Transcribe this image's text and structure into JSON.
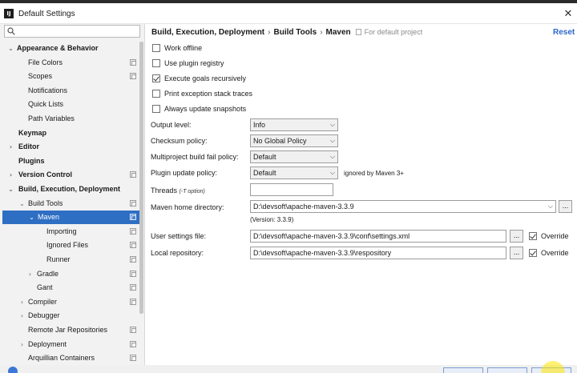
{
  "window": {
    "title": "Default Settings",
    "app_icon_text": "IJ",
    "close_glyph": "✕"
  },
  "sidebar": {
    "search": {
      "value": "",
      "placeholder": "",
      "icon": "search-icon"
    },
    "items": [
      {
        "label": "Appearance & Behavior",
        "bold": true,
        "arrow": "expanded",
        "copy_icon": false
      },
      {
        "label": "File Colors",
        "bold": false,
        "arrow": "none",
        "copy_icon": true
      },
      {
        "label": "Scopes",
        "bold": false,
        "arrow": "none",
        "copy_icon": true
      },
      {
        "label": "Notifications",
        "bold": false,
        "arrow": "none",
        "copy_icon": false
      },
      {
        "label": "Quick Lists",
        "bold": false,
        "arrow": "none",
        "copy_icon": false
      },
      {
        "label": "Path Variables",
        "bold": false,
        "arrow": "none",
        "copy_icon": false
      },
      {
        "label": "Keymap",
        "bold": true,
        "arrow": "none",
        "copy_icon": false
      },
      {
        "label": "Editor",
        "bold": true,
        "arrow": "collapsed",
        "copy_icon": false
      },
      {
        "label": "Plugins",
        "bold": true,
        "arrow": "none",
        "copy_icon": false
      },
      {
        "label": "Version Control",
        "bold": true,
        "arrow": "collapsed",
        "copy_icon": true
      },
      {
        "label": "Build, Execution, Deployment",
        "bold": true,
        "arrow": "expanded",
        "copy_icon": false
      },
      {
        "label": "Build Tools",
        "bold": false,
        "arrow": "expanded",
        "copy_icon": true
      },
      {
        "label": "Maven",
        "bold": false,
        "arrow": "expanded",
        "copy_icon": true,
        "selected": true
      },
      {
        "label": "Importing",
        "bold": false,
        "arrow": "none",
        "copy_icon": true
      },
      {
        "label": "Ignored Files",
        "bold": false,
        "arrow": "none",
        "copy_icon": true
      },
      {
        "label": "Runner",
        "bold": false,
        "arrow": "none",
        "copy_icon": true
      },
      {
        "label": "Gradle",
        "bold": false,
        "arrow": "collapsed",
        "copy_icon": true
      },
      {
        "label": "Gant",
        "bold": false,
        "arrow": "none",
        "copy_icon": true
      },
      {
        "label": "Compiler",
        "bold": false,
        "arrow": "collapsed",
        "copy_icon": true
      },
      {
        "label": "Debugger",
        "bold": false,
        "arrow": "collapsed",
        "copy_icon": false
      },
      {
        "label": "Remote Jar Repositories",
        "bold": false,
        "arrow": "none",
        "copy_icon": true
      },
      {
        "label": "Deployment",
        "bold": false,
        "arrow": "collapsed",
        "copy_icon": true
      },
      {
        "label": "Arquillian Containers",
        "bold": false,
        "arrow": "none",
        "copy_icon": true
      }
    ]
  },
  "main": {
    "breadcrumb": [
      "Build, Execution, Deployment",
      "Build Tools",
      "Maven"
    ],
    "breadcrumb_separator": "›",
    "scope_text": "For default project",
    "reset_label": "Reset",
    "checkboxes": [
      {
        "label": "Work offline",
        "checked": false
      },
      {
        "label": "Use plugin registry",
        "checked": false
      },
      {
        "label": "Execute goals recursively",
        "checked": true
      },
      {
        "label": "Print exception stack traces",
        "checked": false
      },
      {
        "label": "Always update snapshots",
        "checked": false
      }
    ],
    "output_level": {
      "label": "Output level:",
      "value": "Info"
    },
    "checksum_policy": {
      "label": "Checksum policy:",
      "value": "No Global Policy"
    },
    "multiproject_fail_policy": {
      "label": "Multiproject build fail policy:",
      "value": "Default"
    },
    "plugin_update_policy": {
      "label": "Plugin update policy:",
      "value": "Default",
      "note": "ignored by Maven 3+"
    },
    "threads": {
      "label": "Threads",
      "hint": "(-T option)",
      "value": ""
    },
    "maven_home": {
      "label": "Maven home directory:",
      "value": "D:\\devsoft\\apache-maven-3.3.9",
      "version": "(Version: 3.3.9)",
      "browse": "..."
    },
    "user_settings": {
      "label": "User settings file:",
      "value": "D:\\devsoft\\apache-maven-3.3.9\\conf\\settings.xml",
      "browse": "...",
      "override_label": "Override",
      "override_checked": true
    },
    "local_repository": {
      "label": "Local repository:",
      "value": "D:\\devsoft\\apache-maven-3.3.9\\respository",
      "browse": "...",
      "override_label": "Override",
      "override_checked": true
    }
  },
  "colors": {
    "selection": "#2e6fc4",
    "link": "#2b67c9",
    "sidebar_bg": "#f2f2f2"
  }
}
